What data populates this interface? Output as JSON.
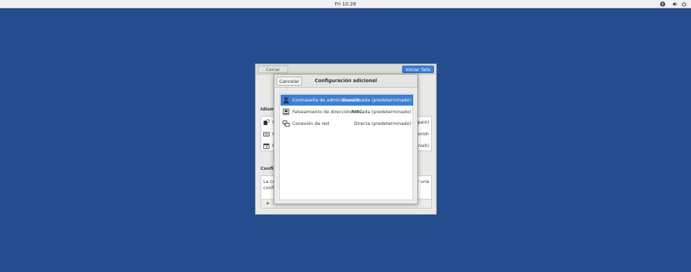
{
  "topbar": {
    "clock": "Fri 10:26",
    "icons": [
      "accessibility-icon",
      "volume-icon",
      "power-icon"
    ]
  },
  "background_window": {
    "close_label": "Cerrar",
    "start_label": "Iniciar Tails",
    "language_section": "Idioma",
    "language_rows": [
      {
        "icon": "language-icon",
        "label": "I",
        "value": "pain)"
      },
      {
        "icon": "keyboard-icon",
        "label": "C",
        "value": "anish"
      },
      {
        "icon": "calendar-icon",
        "label": "F",
        "value": "nish)"
      }
    ],
    "additional_section": "Configu",
    "additional_text_left": [
      "La co",
      "config"
    ],
    "additional_text_right": [
      "ir una"
    ],
    "add_label": "+"
  },
  "dialog": {
    "cancel_label": "Cancelar",
    "title": "Configuración adicional",
    "options": [
      {
        "icon": "user-icon",
        "label": "Contraseña de administración",
        "value": "Desactivada (predeterminado)",
        "selected": true
      },
      {
        "icon": "network-card-icon",
        "label": "Falseamiento de dirección MAC",
        "value": "Activada (predeterminado)",
        "selected": false
      },
      {
        "icon": "network-connection-icon",
        "label": "Conexión de red",
        "value": "Directa (predeterminado)",
        "selected": false
      }
    ]
  },
  "colors": {
    "desktop": "#234d8f",
    "accent": "#3d7fd6"
  }
}
